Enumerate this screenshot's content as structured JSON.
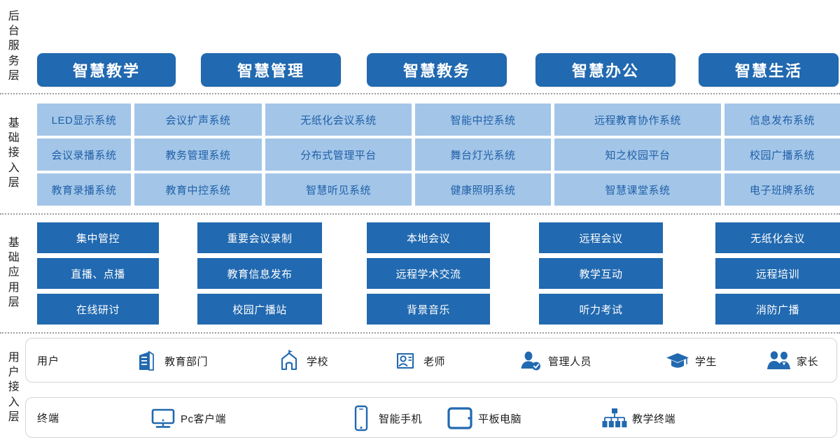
{
  "layers": [
    {
      "id": "backend-service",
      "label_chars": [
        "后",
        "台",
        "服",
        "务",
        "层"
      ]
    },
    {
      "id": "basic-access",
      "label_chars": [
        "基",
        "础",
        "接",
        "入",
        "层"
      ]
    },
    {
      "id": "basic-application",
      "label_chars": [
        "基",
        "础",
        "应",
        "用",
        "层"
      ]
    },
    {
      "id": "user-access",
      "label_chars": [
        "用",
        "户",
        "接",
        "入",
        "层"
      ]
    }
  ],
  "backend_service": {
    "pills": [
      {
        "label": "智慧教学"
      },
      {
        "label": "智慧管理"
      },
      {
        "label": "智慧教务"
      },
      {
        "label": "智慧办公"
      },
      {
        "label": "智慧生活"
      }
    ]
  },
  "basic_access": {
    "columns": [
      {
        "cells": [
          "LED显示系统",
          "会议录播系统",
          "教育录播系统"
        ]
      },
      {
        "cells": [
          "会议扩声系统",
          "教务管理系统",
          "教育中控系统"
        ]
      },
      {
        "cells": [
          "无纸化会议系统",
          "分布式管理平台",
          "智慧听见系统"
        ]
      },
      {
        "cells": [
          "智能中控系统",
          "舞台灯光系统",
          "健康照明系统"
        ]
      },
      {
        "cells": [
          "远程教育协作系统",
          "知之校园平台",
          "智慧课堂系统"
        ]
      },
      {
        "cells": [
          "信息发布系统",
          "校园广播系统",
          "电子班牌系统"
        ]
      }
    ]
  },
  "basic_application": {
    "columns": [
      {
        "cells": [
          "集中管控",
          "直播、点播",
          "在线研讨"
        ]
      },
      {
        "cells": [
          "重要会议录制",
          "教育信息发布",
          "校园广播站"
        ]
      },
      {
        "cells": [
          "本地会议",
          "远程学术交流",
          "背景音乐"
        ]
      },
      {
        "cells": [
          "远程会议",
          "教学互动",
          "听力考试"
        ]
      },
      {
        "cells": [
          "无纸化会议",
          "远程培训",
          "消防广播"
        ]
      }
    ]
  },
  "user_access": {
    "users_panel": {
      "title": "用户",
      "items": [
        {
          "label": "教育部门",
          "icon": "building-icon"
        },
        {
          "label": "学校",
          "icon": "school-icon"
        },
        {
          "label": "老师",
          "icon": "teacher-card-icon"
        },
        {
          "label": "管理人员",
          "icon": "admin-person-icon"
        },
        {
          "label": "学生",
          "icon": "graduation-cap-icon"
        },
        {
          "label": "家长",
          "icon": "parents-icon"
        }
      ]
    },
    "terminals_panel": {
      "title": "终端",
      "items": [
        {
          "label": "Pc客户端",
          "icon": "desktop-monitor-icon"
        },
        {
          "label": "智能手机",
          "icon": "smartphone-icon"
        },
        {
          "label": "平板电脑",
          "icon": "tablet-icon"
        },
        {
          "label": "教学终端",
          "icon": "network-terminal-icon"
        }
      ]
    }
  },
  "colors": {
    "primary_blue": "#2169b0",
    "light_blue": "#a3c6e8",
    "light_blue_text": "#1f5fa8",
    "divider": "#9aa0a6",
    "panel_border": "#d2d4d7",
    "text_dark": "#1c1c1c"
  }
}
